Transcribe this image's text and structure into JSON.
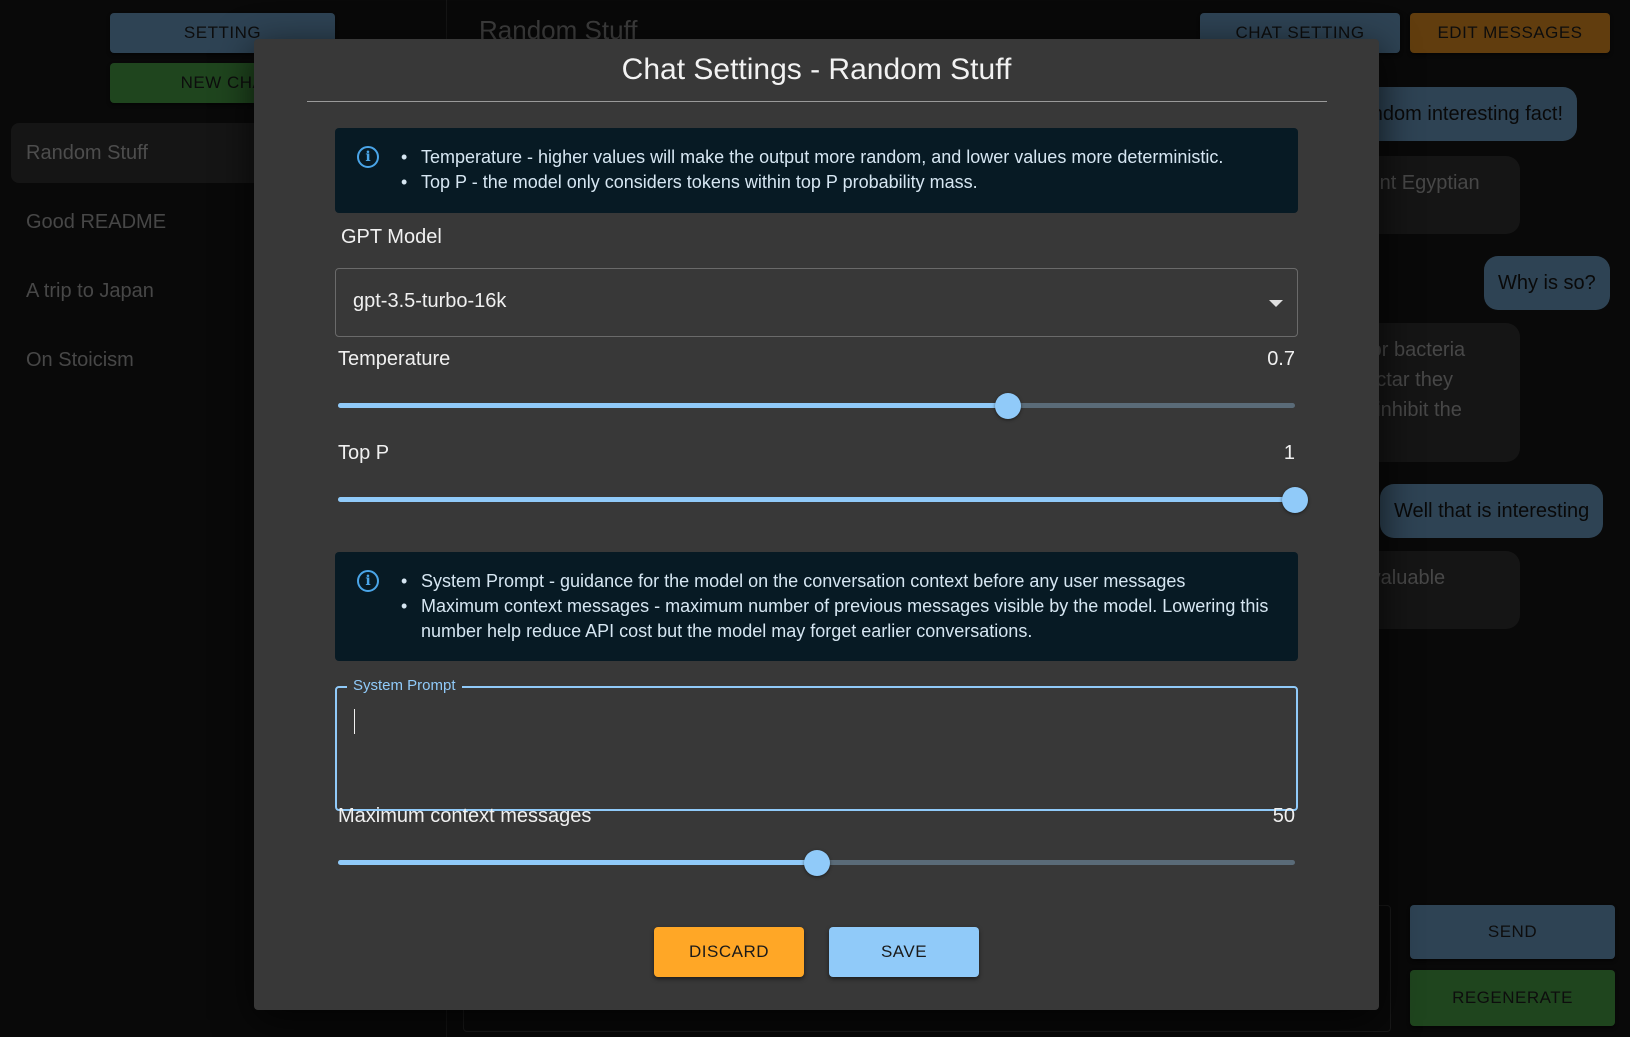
{
  "sidebar": {
    "setting_label": "SETTING",
    "new_chat_label": "NEW CHA",
    "chats": [
      {
        "label": "Random Stuff",
        "active": true
      },
      {
        "label": "Good README",
        "active": false
      },
      {
        "label": "A trip to Japan",
        "active": false
      },
      {
        "label": "On Stoicism",
        "active": false
      }
    ]
  },
  "main": {
    "title": "Random Stuff",
    "chat_setting_label": "CHAT SETTING",
    "edit_messages_label": "EDIT MESSAGES",
    "send_label": "SEND",
    "regenerate_label": "REGENERATE",
    "messages": [
      {
        "role": "user",
        "text": "random interesting fact!"
      },
      {
        "role": "bot",
        "text": "cient Egyptian"
      },
      {
        "role": "user",
        "text": "Why is so?"
      },
      {
        "role": "bot",
        "text": "t for bacteria\nnectar they\nto inhibit the"
      },
      {
        "role": "user",
        "text": "Well that is interesting"
      },
      {
        "role": "bot",
        "text": "a valuable"
      }
    ]
  },
  "dialog": {
    "title": "Chat Settings - Random Stuff",
    "info1": {
      "icon": "info-icon",
      "lines": [
        "Temperature - higher values will make the output more random, and lower values more deterministic.",
        "Top P - the model only considers tokens within top P probability mass."
      ]
    },
    "model": {
      "label": "GPT Model",
      "value": "gpt-3.5-turbo-16k"
    },
    "temperature": {
      "label": "Temperature",
      "value": "0.7",
      "fraction": 0.7
    },
    "top_p": {
      "label": "Top P",
      "value": "1",
      "fraction": 1.0
    },
    "info2": {
      "icon": "info-icon",
      "lines": [
        "System Prompt - guidance for the model on the conversation context before any user messages",
        "Maximum context messages - maximum number of previous messages visible by the model. Lowering this number help reduce API cost but the model may forget earlier conversations."
      ]
    },
    "system_prompt": {
      "label": "System Prompt",
      "value": ""
    },
    "max_context": {
      "label": "Maximum context messages",
      "value": "50",
      "fraction": 0.5
    },
    "discard_label": "DISCARD",
    "save_label": "SAVE"
  },
  "colors": {
    "accent": "#90caf9",
    "warning": "#ffa726",
    "dialog_bg": "#383838",
    "info_bg": "#071a24"
  }
}
